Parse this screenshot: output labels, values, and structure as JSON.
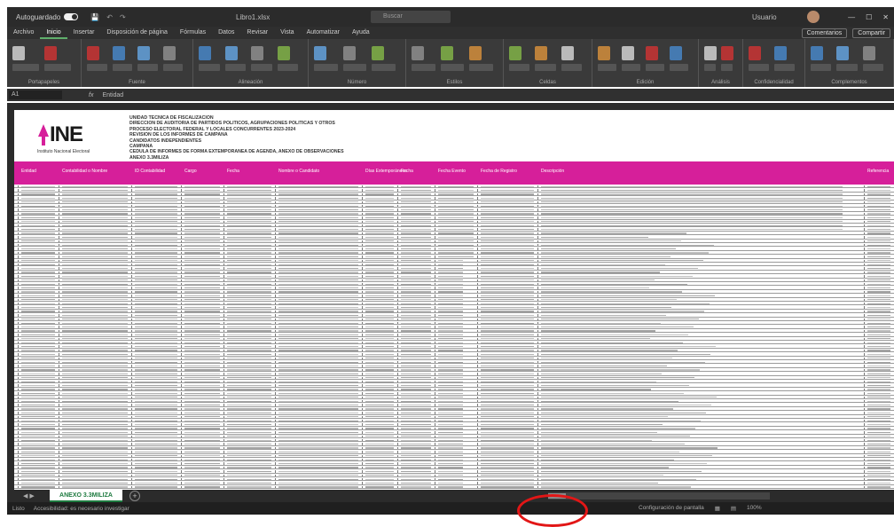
{
  "titlebar": {
    "autosave_label": "Autoguardado",
    "doc_title": "Libro1.xlsx",
    "search_placeholder": "Buscar",
    "user_name": "Usuario",
    "min": "—",
    "max": "☐",
    "close": "✕"
  },
  "ribbon_tabs": [
    "Archivo",
    "Inicio",
    "Insertar",
    "Disposición de página",
    "Fórmulas",
    "Datos",
    "Revisar",
    "Vista",
    "Automatizar",
    "Ayuda"
  ],
  "ribbon_tabs_active": 1,
  "ribbon_right": {
    "comments": "Comentarios",
    "share": "Compartir"
  },
  "ribbon_groups": [
    "Portapapeles",
    "Fuente",
    "Alineación",
    "Número",
    "Estilos",
    "Celdas",
    "Edición",
    "Análisis",
    "Confidencialidad",
    "Complementos"
  ],
  "formula_bar": {
    "name_box": "A1",
    "fx": "fx",
    "value": "Entidad"
  },
  "sheet": {
    "logo_text": "INE",
    "logo_sub": "Instituto Nacional Electoral",
    "header_lines": [
      "UNIDAD TÉCNICA DE FISCALIZACIÓN",
      "DIRECCIÓN DE AUDITORÍA DE PARTIDOS POLÍTICOS, AGRUPACIONES POLÍTICAS Y OTROS",
      "PROCESO ELECTORAL FEDERAL Y LOCALES CONCURRENTES 2023-2024",
      "REVISIÓN DE LOS INFORMES DE CAMPAÑA",
      "CANDIDATOS INDEPENDIENTES",
      "CAMPAÑA",
      "CÉDULA DE INFORMES DE FORMA EXTEMPORÁNEA DE AGENDA, ANEXO DE OBSERVACIONES",
      "ANEXO 3.3MILIZA"
    ],
    "columns": [
      "Entidad",
      "Contabilidad o Nombre",
      "ID Contabilidad",
      "Cargo",
      "Fecha",
      "Nombre o Candidato",
      "Días Extemporáneos",
      "Fecha",
      "Fecha Evento",
      "Fecha de Registro",
      "Descripción",
      "Referencia"
    ]
  },
  "sheet_tab": "ANEXO 3.3MILIZA",
  "statusbar": {
    "ready": "Listo",
    "accessibility": "Accesibilidad: es necesario investigar",
    "display_settings": "Configuración de pantalla",
    "zoom": "100%"
  },
  "colors": {
    "header_band": "#d61f9a",
    "title_bar": "#2b2b2b",
    "sheet_tab_accent": "#1e7b40",
    "annotation": "#e21616"
  }
}
